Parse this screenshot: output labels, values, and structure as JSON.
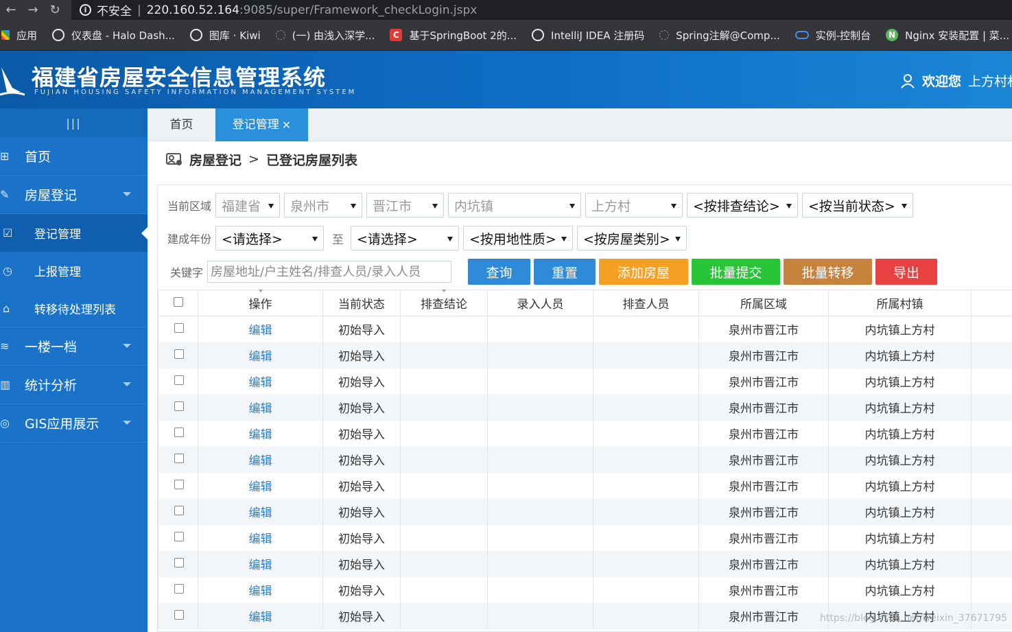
{
  "browser": {
    "back": "←",
    "forward": "→",
    "reload": "↻",
    "security_label": "不安全",
    "url_host": "220.160.52.164",
    "url_path": ":9085/super/Framework_checkLogin.jspx"
  },
  "bookmarks": [
    {
      "label": "应用",
      "icon": "apps-icon"
    },
    {
      "label": "仪表盘 - Halo Dash...",
      "icon": "globe-icon"
    },
    {
      "label": "图库 · Kiwi",
      "icon": "globe-icon"
    },
    {
      "label": "(一) 由浅入深学...",
      "icon": "page-icon"
    },
    {
      "label": "基于SpringBoot 2的...",
      "icon": "csdn-icon"
    },
    {
      "label": "IntelliJ IDEA 注册码",
      "icon": "globe-icon"
    },
    {
      "label": "Spring注解@Comp...",
      "icon": "page-icon"
    },
    {
      "label": "实例-控制台",
      "icon": "cloud-icon"
    },
    {
      "label": "Nginx 安装配置 | 菜...",
      "icon": "nginx-icon"
    }
  ],
  "header": {
    "title": "福建省房屋安全信息管理系统",
    "subtitle": "FUJIAN HOUSING SAFETY INFORMATION MANAGEMENT SYSTEM",
    "welcome": "欢迎您",
    "username": "上方村村"
  },
  "sidebar": {
    "toggle": "|||",
    "items": [
      {
        "label": "首页",
        "icon": "home-icon"
      },
      {
        "label": "房屋登记",
        "icon": "register-icon"
      },
      {
        "label": "登记管理",
        "icon": "checkbox-icon"
      },
      {
        "label": "上报管理",
        "icon": "clock-icon"
      },
      {
        "label": "转移待处理列表",
        "icon": "house-icon"
      },
      {
        "label": "一楼一档",
        "icon": "layers-icon"
      },
      {
        "label": "统计分析",
        "icon": "chart-icon"
      },
      {
        "label": "GIS应用展示",
        "icon": "map-pin-icon"
      }
    ]
  },
  "tabs": {
    "home": "首页",
    "active": "登记管理",
    "close": "×"
  },
  "breadcrumb": {
    "parent": "房屋登记",
    "sep": ">",
    "current": "已登记房屋列表"
  },
  "filters": {
    "region_label": "当前区域",
    "province": "福建省",
    "city": "泉州市",
    "county": "晋江市",
    "town": "内坑镇",
    "village": "上方村",
    "conclusion": "<按排查结论>",
    "status": "<按当前状态>",
    "year_label": "建成年份",
    "year_from": "<请选择>",
    "to_label": "至",
    "year_to": "<请选择>",
    "land_use": "<按用地性质>",
    "house_type": "<按房屋类别>",
    "keyword_label": "关键字",
    "keyword_placeholder": "房屋地址/户主姓名/排查人员/录入人员"
  },
  "buttons": {
    "query": "查询",
    "reset": "重置",
    "add": "添加房屋",
    "batch_submit": "批量提交",
    "batch_transfer": "批量转移",
    "export": "导出"
  },
  "colors": {
    "query": "#2f8ad8",
    "reset": "#2f8ad8",
    "add": "#f5a023",
    "batch_submit": "#29c539",
    "batch_transfer": "#c7823e",
    "export": "#e84141"
  },
  "table": {
    "columns": [
      "操作",
      "当前状态",
      "排查结论",
      "录入人员",
      "排查人员",
      "所属区域",
      "所属村镇"
    ],
    "rows": [
      [
        "编辑",
        "初始导入",
        "",
        "",
        "",
        "泉州市晋江市",
        "内坑镇上方村"
      ],
      [
        "编辑",
        "初始导入",
        "",
        "",
        "",
        "泉州市晋江市",
        "内坑镇上方村"
      ],
      [
        "编辑",
        "初始导入",
        "",
        "",
        "",
        "泉州市晋江市",
        "内坑镇上方村"
      ],
      [
        "编辑",
        "初始导入",
        "",
        "",
        "",
        "泉州市晋江市",
        "内坑镇上方村"
      ],
      [
        "编辑",
        "初始导入",
        "",
        "",
        "",
        "泉州市晋江市",
        "内坑镇上方村"
      ],
      [
        "编辑",
        "初始导入",
        "",
        "",
        "",
        "泉州市晋江市",
        "内坑镇上方村"
      ],
      [
        "编辑",
        "初始导入",
        "",
        "",
        "",
        "泉州市晋江市",
        "内坑镇上方村"
      ],
      [
        "编辑",
        "初始导入",
        "",
        "",
        "",
        "泉州市晋江市",
        "内坑镇上方村"
      ],
      [
        "编辑",
        "初始导入",
        "",
        "",
        "",
        "泉州市晋江市",
        "内坑镇上方村"
      ],
      [
        "编辑",
        "初始导入",
        "",
        "",
        "",
        "泉州市晋江市",
        "内坑镇上方村"
      ],
      [
        "编辑",
        "初始导入",
        "",
        "",
        "",
        "泉州市晋江市",
        "内坑镇上方村"
      ],
      [
        "编辑",
        "初始导入",
        "",
        "",
        "",
        "泉州市晋江市",
        "内坑镇上方村"
      ]
    ]
  },
  "watermark": "https://blog.csdn.net/weixin_37671795"
}
